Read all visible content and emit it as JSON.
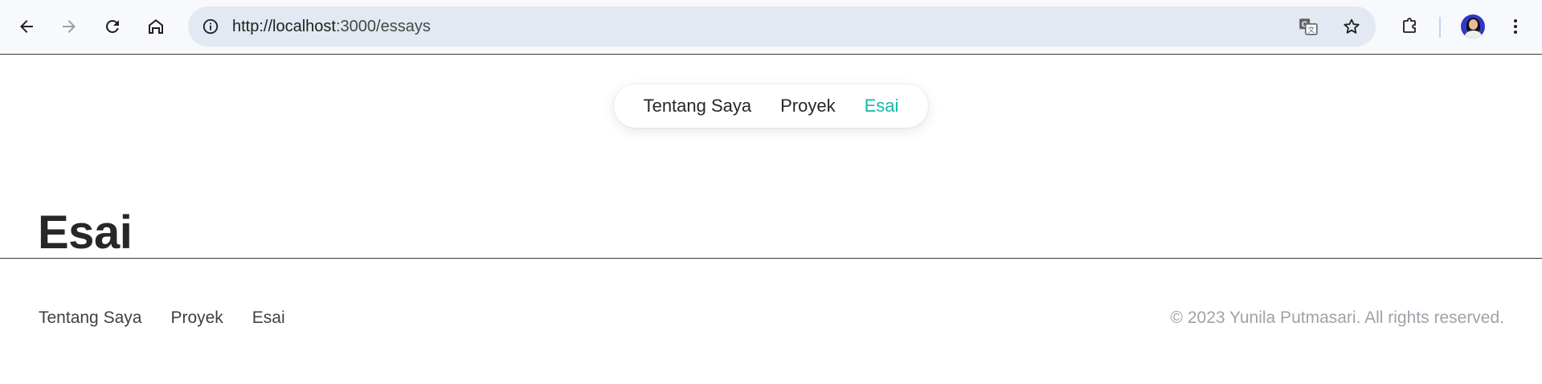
{
  "browser": {
    "url_host": "http://localhost",
    "url_rest": ":3000/essays",
    "icons": {
      "back": "arrow-left-icon",
      "forward": "arrow-right-icon",
      "reload": "reload-icon",
      "home": "home-icon",
      "site_info": "info-icon",
      "translate": "translate-icon",
      "bookmark": "star-icon",
      "extensions": "puzzle-icon",
      "menu": "kebab-menu-icon"
    }
  },
  "nav": {
    "items": [
      {
        "label": "Tentang Saya"
      },
      {
        "label": "Proyek"
      },
      {
        "label": "Esai"
      }
    ],
    "active_color": "#14b8a6"
  },
  "main": {
    "title": "Esai"
  },
  "footer": {
    "links": [
      {
        "label": "Tentang Saya"
      },
      {
        "label": "Proyek"
      },
      {
        "label": "Esai"
      }
    ],
    "copyright": "© 2023 Yunila Putmasari. All rights reserved."
  }
}
